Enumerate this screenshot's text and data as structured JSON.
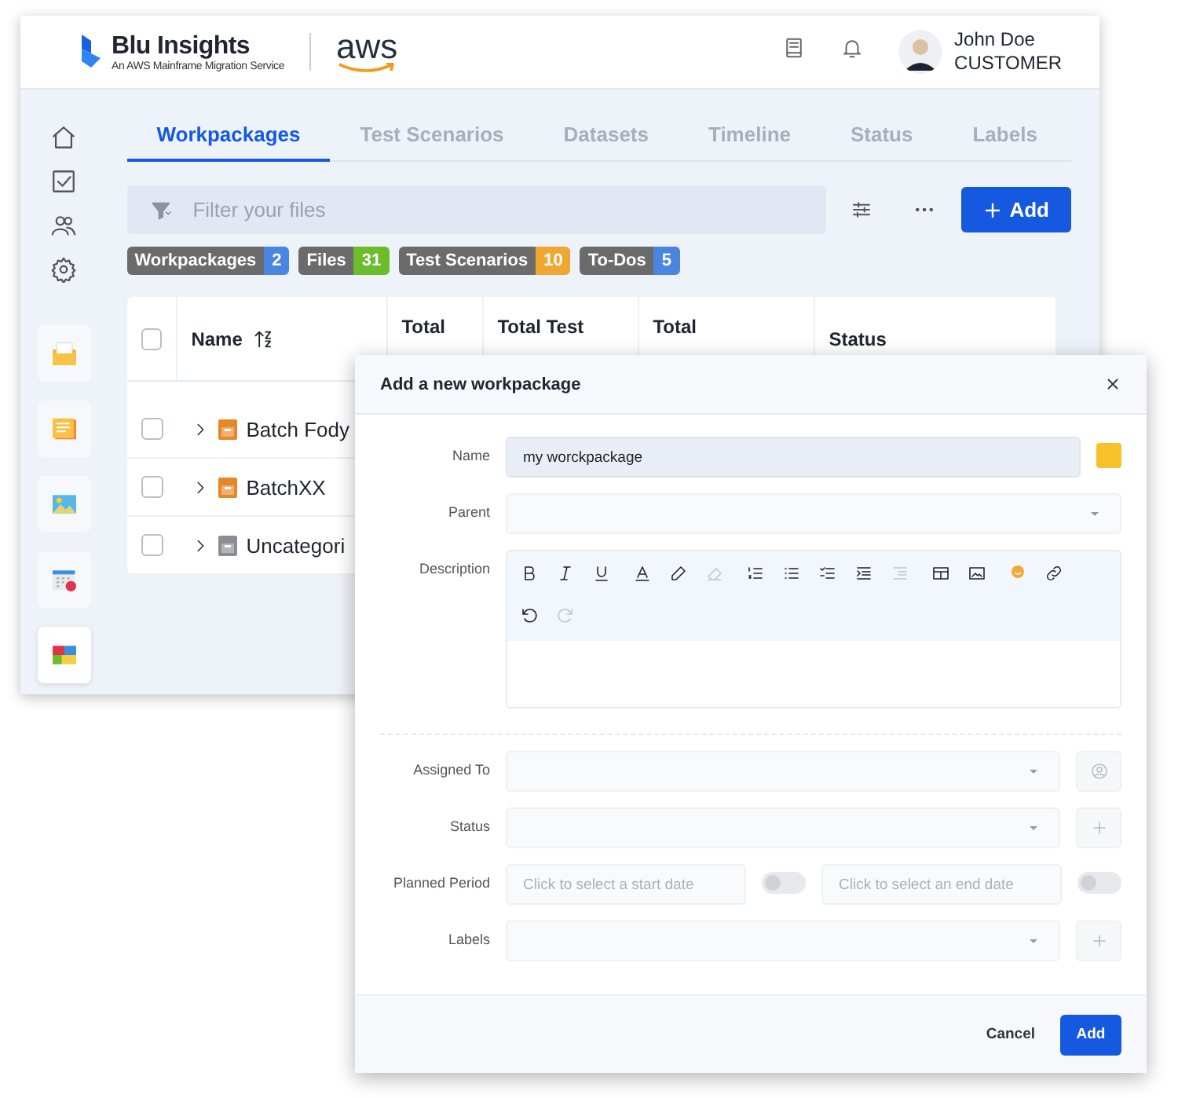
{
  "header": {
    "logo_title": "Blu Insights",
    "logo_subtitle": "An AWS Mainframe Migration Service",
    "partner_logo": "aws",
    "user": {
      "name": "John Doe",
      "role": "CUSTOMER"
    }
  },
  "apps": [
    {
      "selected": false
    },
    {
      "selected": false
    },
    {
      "selected": false
    },
    {
      "selected": false
    },
    {
      "selected": true
    }
  ],
  "tabs": [
    {
      "label": "Workpackages",
      "selected": true
    },
    {
      "label": "Test Scenarios",
      "selected": false
    },
    {
      "label": "Datasets",
      "selected": false
    },
    {
      "label": "Timeline",
      "selected": false
    },
    {
      "label": "Status",
      "selected": false
    },
    {
      "label": "Labels",
      "selected": false
    }
  ],
  "filter": {
    "placeholder": "Filter your files"
  },
  "add_button": "Add",
  "counters": [
    {
      "label": "Workpackages",
      "count": "2",
      "color": "#4a86e0"
    },
    {
      "label": "Files",
      "count": "31",
      "color": "#6cbd2c"
    },
    {
      "label": "Test Scenarios",
      "count": "10",
      "color": "#f0a731"
    },
    {
      "label": "To-Dos",
      "count": "5",
      "color": "#4a86e0"
    }
  ],
  "table": {
    "all_checked": false,
    "columns": [
      "Name",
      "Total",
      "Total Test",
      "Total",
      "Status"
    ],
    "rows": [
      {
        "name": "Batch Fody",
        "checked": false,
        "color": "#e8862a"
      },
      {
        "name": "BatchXX",
        "checked": false,
        "color": "#e8862a"
      },
      {
        "name": "Uncategori",
        "checked": false,
        "color": "#8a8d93"
      }
    ]
  },
  "dialog": {
    "title": "Add a new workpackage",
    "fields": [
      {
        "kind": "text",
        "label": "Name",
        "value": "my worckpackage",
        "color": "#f8c12c"
      },
      {
        "kind": "select",
        "label": "Parent"
      },
      {
        "kind": "editor",
        "label": "Description"
      },
      {
        "kind": "select",
        "label": "Assigned To",
        "side_button": {
          "kind": "user"
        }
      },
      {
        "kind": "select",
        "label": "Status",
        "side_button": {
          "kind": "plus"
        }
      },
      {
        "kind": "dates",
        "label": "Planned Period",
        "start_placeholder": "Click to select a start date",
        "end_placeholder": "Click to select an end date",
        "start_on": false,
        "end_on": false
      },
      {
        "kind": "select",
        "label": "Labels",
        "side_button": {
          "kind": "plus"
        }
      }
    ],
    "buttons": [
      {
        "label": "Cancel",
        "kind": "secondary"
      },
      {
        "label": "Add",
        "kind": "primary"
      }
    ]
  }
}
